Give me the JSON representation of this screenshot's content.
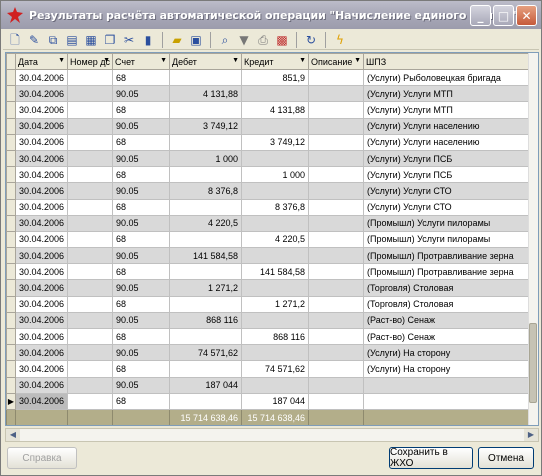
{
  "window": {
    "title": "Результаты расчёта автоматической операции \"Начисление единого налога\"",
    "controls": [
      "_",
      "□",
      "✕"
    ]
  },
  "toolbar": {
    "icons": [
      "new-doc-icon",
      "edit-doc-icon",
      "copy-doc-icon",
      "print-doc-icon",
      "paste-doc-icon",
      "copy-icon",
      "cut-icon",
      "delete-icon",
      "open-folder-icon",
      "save-icon",
      "find-icon",
      "filter-icon",
      "print-icon",
      "calc-icon",
      "refresh-icon",
      "lightning-icon"
    ]
  },
  "table": {
    "columns": [
      "Дата",
      "Номер дс",
      "Счет",
      "Дебет",
      "Кредит",
      "Описание",
      "ШПЗ"
    ],
    "rows": [
      [
        "30.04.2006",
        "",
        "68",
        "",
        "851,9",
        "",
        "(Услуги) Рыболовецкая бригада"
      ],
      [
        "30.04.2006",
        "",
        "90.05",
        "4 131,88",
        "",
        "",
        "(Услуги) Услуги МТП"
      ],
      [
        "30.04.2006",
        "",
        "68",
        "",
        "4 131,88",
        "",
        "(Услуги) Услуги МТП"
      ],
      [
        "30.04.2006",
        "",
        "90.05",
        "3 749,12",
        "",
        "",
        "(Услуги) Услуги населению"
      ],
      [
        "30.04.2006",
        "",
        "68",
        "",
        "3 749,12",
        "",
        "(Услуги) Услуги населению"
      ],
      [
        "30.04.2006",
        "",
        "90.05",
        "1 000",
        "",
        "",
        "(Услуги) Услуги ПСБ"
      ],
      [
        "30.04.2006",
        "",
        "68",
        "",
        "1 000",
        "",
        "(Услуги) Услуги ПСБ"
      ],
      [
        "30.04.2006",
        "",
        "90.05",
        "8 376,8",
        "",
        "",
        "(Услуги) Услуги СТО"
      ],
      [
        "30.04.2006",
        "",
        "68",
        "",
        "8 376,8",
        "",
        "(Услуги) Услуги СТО"
      ],
      [
        "30.04.2006",
        "",
        "90.05",
        "4 220,5",
        "",
        "",
        "(Промышл) Услуги пилорамы"
      ],
      [
        "30.04.2006",
        "",
        "68",
        "",
        "4 220,5",
        "",
        "(Промышл) Услуги пилорамы"
      ],
      [
        "30.04.2006",
        "",
        "90.05",
        "141 584,58",
        "",
        "",
        "(Промышл) Протравливание зерна"
      ],
      [
        "30.04.2006",
        "",
        "68",
        "",
        "141 584,58",
        "",
        "(Промышл) Протравливание зерна"
      ],
      [
        "30.04.2006",
        "",
        "90.05",
        "1 271,2",
        "",
        "",
        "(Торговля) Столовая"
      ],
      [
        "30.04.2006",
        "",
        "68",
        "",
        "1 271,2",
        "",
        "(Торговля) Столовая"
      ],
      [
        "30.04.2006",
        "",
        "90.05",
        "868 116",
        "",
        "",
        "(Раст-во) Сенаж"
      ],
      [
        "30.04.2006",
        "",
        "68",
        "",
        "868 116",
        "",
        "(Раст-во) Сенаж"
      ],
      [
        "30.04.2006",
        "",
        "90.05",
        "74 571,62",
        "",
        "",
        "(Услуги) На сторону"
      ],
      [
        "30.04.2006",
        "",
        "68",
        "",
        "74 571,62",
        "",
        "(Услуги) На сторону"
      ],
      [
        "30.04.2006",
        "",
        "90.05",
        "187 044",
        "",
        "",
        ""
      ],
      [
        "30.04.2006",
        "",
        "68",
        "",
        "187 044",
        "",
        ""
      ]
    ],
    "current_row_marker": "▶",
    "totals": {
      "debit": "15 714 638,46",
      "credit": "15 714 638,46"
    }
  },
  "buttons": {
    "help": "Справка",
    "save": "Сохранить в ЖХО",
    "cancel": "Отмена"
  }
}
